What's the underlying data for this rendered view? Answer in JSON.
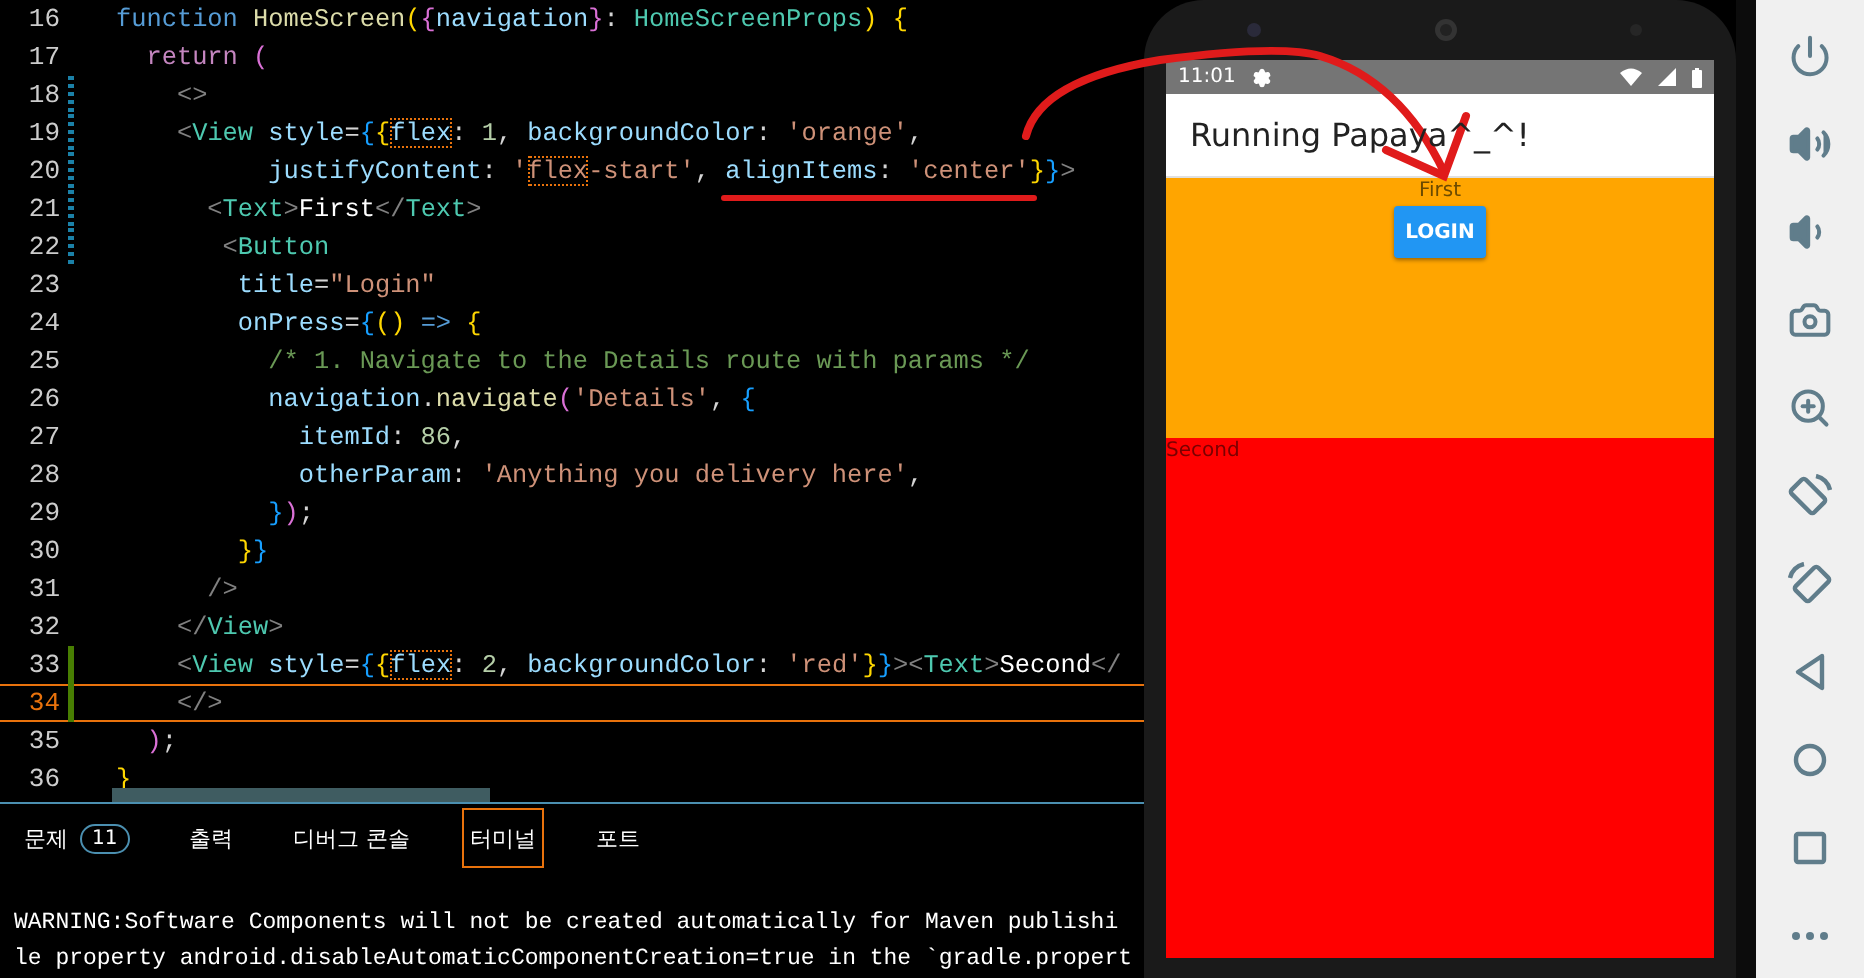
{
  "editor": {
    "lines": [
      {
        "number": "16",
        "kind": "plain",
        "tokens": [
          {
            "kind": "keyword",
            "text": "function "
          },
          {
            "kind": "func",
            "text": "HomeScreen"
          },
          {
            "kind": "bracket1",
            "text": "("
          },
          {
            "kind": "bracket2",
            "text": "{"
          },
          {
            "kind": "var",
            "text": "navigation"
          },
          {
            "kind": "bracket2",
            "text": "}"
          },
          {
            "kind": "plain",
            "text": ": "
          },
          {
            "kind": "type",
            "text": "HomeScreenProps"
          },
          {
            "kind": "bracket1",
            "text": ") {"
          }
        ]
      },
      {
        "number": "17",
        "kind": "plain",
        "tokens": [
          {
            "kind": "control",
            "text": "  return "
          },
          {
            "kind": "bracket2",
            "text": "("
          }
        ]
      },
      {
        "number": "18",
        "kind": "modified",
        "tokens": [
          {
            "kind": "punct",
            "text": "    <>"
          }
        ]
      },
      {
        "number": "19",
        "kind": "modified",
        "tokens": [
          {
            "kind": "punct",
            "text": "    <"
          },
          {
            "kind": "type",
            "text": "View "
          },
          {
            "kind": "var",
            "text": "style"
          },
          {
            "kind": "plain",
            "text": "="
          },
          {
            "kind": "bracket3",
            "text": "{"
          },
          {
            "kind": "bracket1",
            "text": "{"
          },
          {
            "kind": "var",
            "text": "flex",
            "boxed": true
          },
          {
            "kind": "plain",
            "text": ": "
          },
          {
            "kind": "number",
            "text": "1"
          },
          {
            "kind": "plain",
            "text": ", "
          },
          {
            "kind": "var",
            "text": "backgroundColor"
          },
          {
            "kind": "plain",
            "text": ": "
          },
          {
            "kind": "string",
            "text": "'orange'"
          },
          {
            "kind": "plain",
            "text": ","
          }
        ]
      },
      {
        "number": "20",
        "kind": "modified",
        "tokens": [
          {
            "kind": "var",
            "text": "          justifyContent"
          },
          {
            "kind": "plain",
            "text": ": "
          },
          {
            "kind": "string",
            "text": "'"
          },
          {
            "kind": "string",
            "text": "flex",
            "boxed": true
          },
          {
            "kind": "string",
            "text": "-start'"
          },
          {
            "kind": "plain",
            "text": ", "
          },
          {
            "kind": "var",
            "text": "alignItems"
          },
          {
            "kind": "plain",
            "text": ": "
          },
          {
            "kind": "string",
            "text": "'center'"
          },
          {
            "kind": "bracket1",
            "text": "}"
          },
          {
            "kind": "bracket3",
            "text": "}"
          },
          {
            "kind": "punct",
            "text": ">"
          }
        ]
      },
      {
        "number": "21",
        "kind": "modified",
        "tokens": [
          {
            "kind": "punct",
            "text": "      <"
          },
          {
            "kind": "type",
            "text": "Text"
          },
          {
            "kind": "punct",
            "text": ">"
          },
          {
            "kind": "white",
            "text": "First"
          },
          {
            "kind": "punct",
            "text": "</"
          },
          {
            "kind": "type",
            "text": "Text"
          },
          {
            "kind": "punct",
            "text": ">"
          }
        ]
      },
      {
        "number": "22",
        "kind": "modified",
        "tokens": [
          {
            "kind": "punct",
            "text": "       <"
          },
          {
            "kind": "type",
            "text": "Button"
          }
        ]
      },
      {
        "number": "23",
        "kind": "plain",
        "tokens": [
          {
            "kind": "var",
            "text": "        title"
          },
          {
            "kind": "plain",
            "text": "="
          },
          {
            "kind": "string",
            "text": "\"Login\""
          }
        ]
      },
      {
        "number": "24",
        "kind": "plain",
        "tokens": [
          {
            "kind": "var",
            "text": "        onPress"
          },
          {
            "kind": "plain",
            "text": "="
          },
          {
            "kind": "bracket3",
            "text": "{"
          },
          {
            "kind": "bracket1",
            "text": "() "
          },
          {
            "kind": "keyword",
            "text": "=> "
          },
          {
            "kind": "bracket1",
            "text": "{"
          }
        ]
      },
      {
        "number": "25",
        "kind": "plain",
        "tokens": [
          {
            "kind": "comment",
            "text": "          /* 1. Navigate to the Details route with params */"
          }
        ]
      },
      {
        "number": "26",
        "kind": "plain",
        "tokens": [
          {
            "kind": "var",
            "text": "          navigation"
          },
          {
            "kind": "plain",
            "text": "."
          },
          {
            "kind": "func",
            "text": "navigate"
          },
          {
            "kind": "bracket2",
            "text": "("
          },
          {
            "kind": "string",
            "text": "'Details'"
          },
          {
            "kind": "plain",
            "text": ", "
          },
          {
            "kind": "bracket3",
            "text": "{"
          }
        ]
      },
      {
        "number": "27",
        "kind": "plain",
        "tokens": [
          {
            "kind": "var",
            "text": "            itemId"
          },
          {
            "kind": "plain",
            "text": ": "
          },
          {
            "kind": "number",
            "text": "86"
          },
          {
            "kind": "plain",
            "text": ","
          }
        ]
      },
      {
        "number": "28",
        "kind": "plain",
        "tokens": [
          {
            "kind": "var",
            "text": "            otherParam"
          },
          {
            "kind": "plain",
            "text": ": "
          },
          {
            "kind": "string",
            "text": "'Anything you delivery here'"
          },
          {
            "kind": "plain",
            "text": ","
          }
        ]
      },
      {
        "number": "29",
        "kind": "plain",
        "tokens": [
          {
            "kind": "bracket3",
            "text": "          }"
          },
          {
            "kind": "bracket2",
            "text": ")"
          },
          {
            "kind": "plain",
            "text": ";"
          }
        ]
      },
      {
        "number": "30",
        "kind": "plain",
        "tokens": [
          {
            "kind": "bracket1",
            "text": "        }"
          },
          {
            "kind": "bracket3",
            "text": "}"
          }
        ]
      },
      {
        "number": "31",
        "kind": "plain",
        "tokens": [
          {
            "kind": "punct",
            "text": "      />"
          }
        ]
      },
      {
        "number": "32",
        "kind": "plain",
        "tokens": [
          {
            "kind": "punct",
            "text": "    </"
          },
          {
            "kind": "type",
            "text": "View"
          },
          {
            "kind": "punct",
            "text": ">"
          }
        ]
      },
      {
        "number": "33",
        "kind": "added",
        "tokens": [
          {
            "kind": "punct",
            "text": "    <"
          },
          {
            "kind": "type",
            "text": "View "
          },
          {
            "kind": "var",
            "text": "style"
          },
          {
            "kind": "plain",
            "text": "="
          },
          {
            "kind": "bracket3",
            "text": "{"
          },
          {
            "kind": "bracket1",
            "text": "{"
          },
          {
            "kind": "var",
            "text": "flex",
            "boxed": true
          },
          {
            "kind": "plain",
            "text": ": "
          },
          {
            "kind": "number",
            "text": "2"
          },
          {
            "kind": "plain",
            "text": ", "
          },
          {
            "kind": "var",
            "text": "backgroundColor"
          },
          {
            "kind": "plain",
            "text": ": "
          },
          {
            "kind": "string",
            "text": "'red'"
          },
          {
            "kind": "bracket1",
            "text": "}"
          },
          {
            "kind": "bracket3",
            "text": "}"
          },
          {
            "kind": "punct",
            "text": "><"
          },
          {
            "kind": "type",
            "text": "Text"
          },
          {
            "kind": "punct",
            "text": ">"
          },
          {
            "kind": "white",
            "text": "Second"
          },
          {
            "kind": "punct",
            "text": "</"
          }
        ]
      },
      {
        "number": "34",
        "kind": "added",
        "current": true,
        "tokens": [
          {
            "kind": "punct",
            "text": "    </>"
          }
        ]
      },
      {
        "number": "35",
        "kind": "plain",
        "tokens": [
          {
            "kind": "bracket2",
            "text": "  )"
          },
          {
            "kind": "plain",
            "text": ";"
          }
        ]
      },
      {
        "number": "36",
        "kind": "plain",
        "tokens": [
          {
            "kind": "bracket1",
            "text": "}"
          }
        ]
      }
    ]
  },
  "panel": {
    "tabs": [
      {
        "label": "문제",
        "badge": "11",
        "selected": false
      },
      {
        "label": "출력",
        "selected": false
      },
      {
        "label": "디버그 콘솔",
        "selected": false
      },
      {
        "label": "터미널",
        "selected": true
      },
      {
        "label": "포트",
        "selected": false
      }
    ],
    "terminal_lines": [
      "WARNING:Software Components will not be created automatically for Maven publishi",
      "le property android.disableAutomaticComponentCreation=true in the `gradle.propert"
    ]
  },
  "emulator": {
    "status_time": "11:01",
    "app_title": "Running Papaya^_^!",
    "top_view": {
      "text": "First",
      "button": "LOGIN"
    },
    "bottom_view": {
      "text": "Second"
    }
  }
}
